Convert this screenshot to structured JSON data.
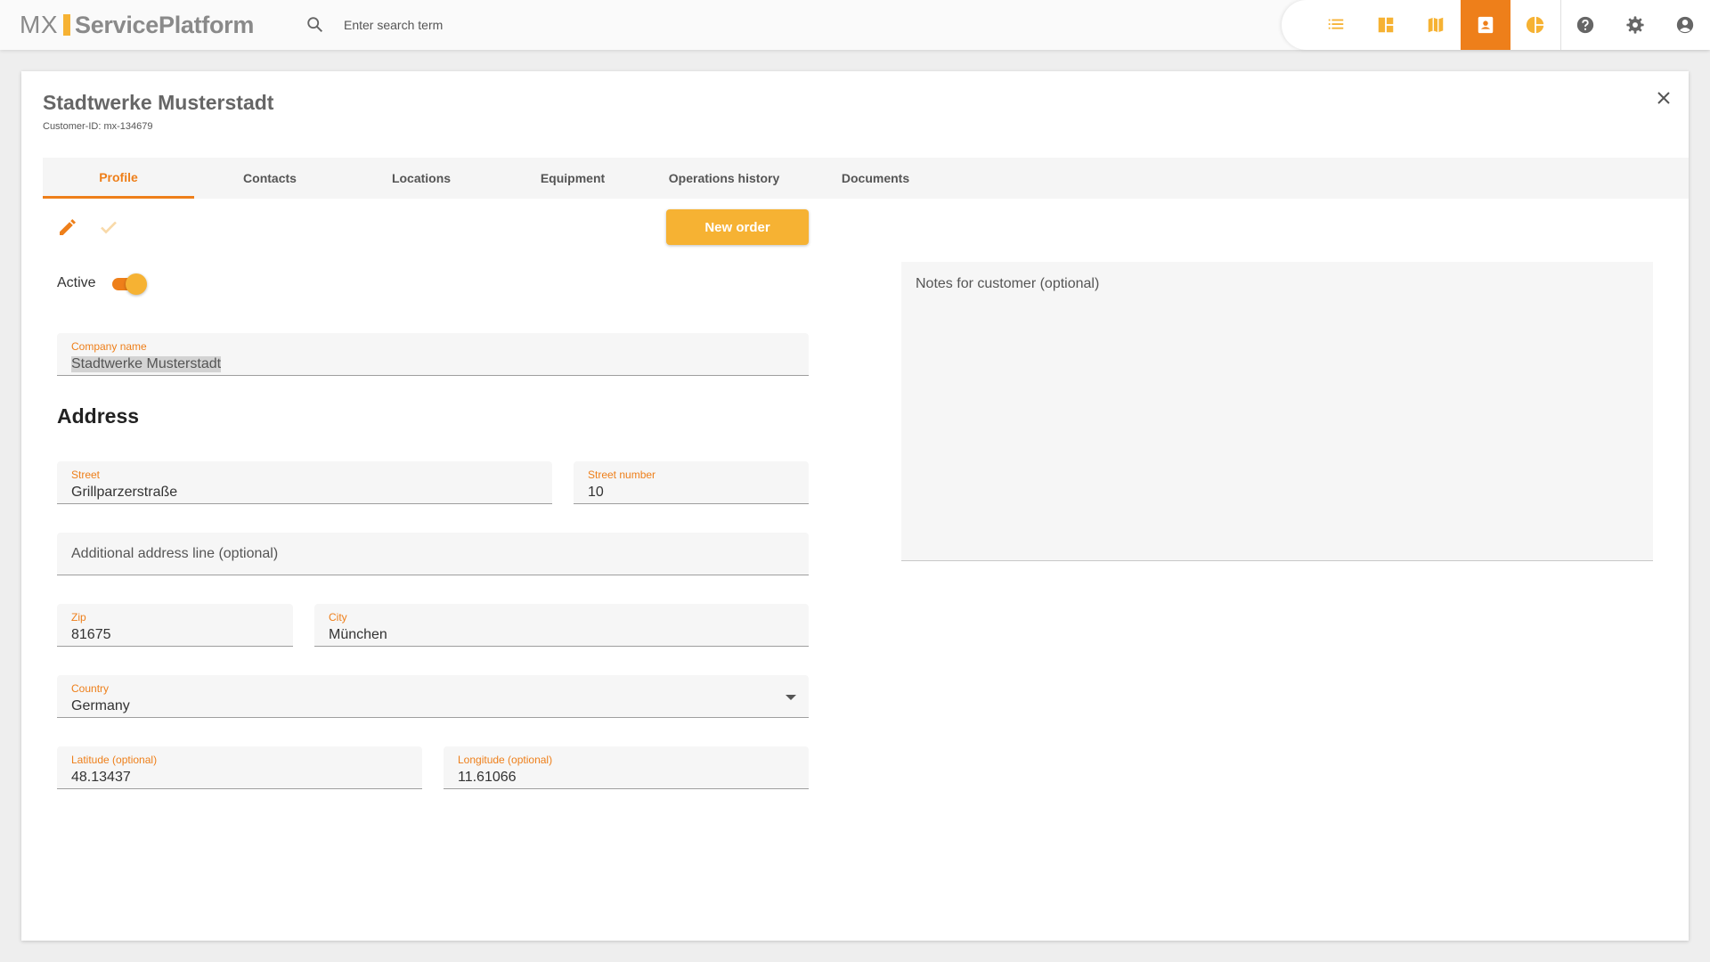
{
  "header": {
    "logo_prefix": "MX",
    "logo_name": "ServicePlatform",
    "search_placeholder": "Enter search term",
    "accent": "#ee7f1a",
    "brand_yellow": "#f6b233",
    "nav_icons": [
      "list-icon",
      "dashboard-icon",
      "map-icon",
      "contacts-icon",
      "pie-chart-icon",
      "help-icon",
      "settings-icon",
      "account-icon"
    ],
    "active_nav": "contacts-icon"
  },
  "customer": {
    "title": "Stadtwerke Musterstadt",
    "customer_id": "Customer-ID: mx-134679"
  },
  "tabs": [
    {
      "label": "Profile",
      "active": true
    },
    {
      "label": "Contacts"
    },
    {
      "label": "Locations"
    },
    {
      "label": "Equipment"
    },
    {
      "label": "Operations history"
    },
    {
      "label": "Documents"
    }
  ],
  "toolbar": {
    "new_order_label": "New order"
  },
  "form": {
    "active_label": "Active",
    "active": true,
    "company_name_label": "Company name",
    "company_name": "Stadtwerke Musterstadt",
    "address_title": "Address",
    "street_label": "Street",
    "street": "Grillparzerstraße",
    "street_number_label": "Street number",
    "street_number": "10",
    "additional_placeholder": "Additional address line (optional)",
    "zip_label": "Zip",
    "zip": "81675",
    "city_label": "City",
    "city": "München",
    "country_label": "Country",
    "country": "Germany",
    "latitude_label": "Latitude (optional)",
    "latitude": "48.13437",
    "longitude_label": "Longitude (optional)",
    "longitude": "11.61066",
    "notes_placeholder": "Notes for customer (optional)"
  }
}
